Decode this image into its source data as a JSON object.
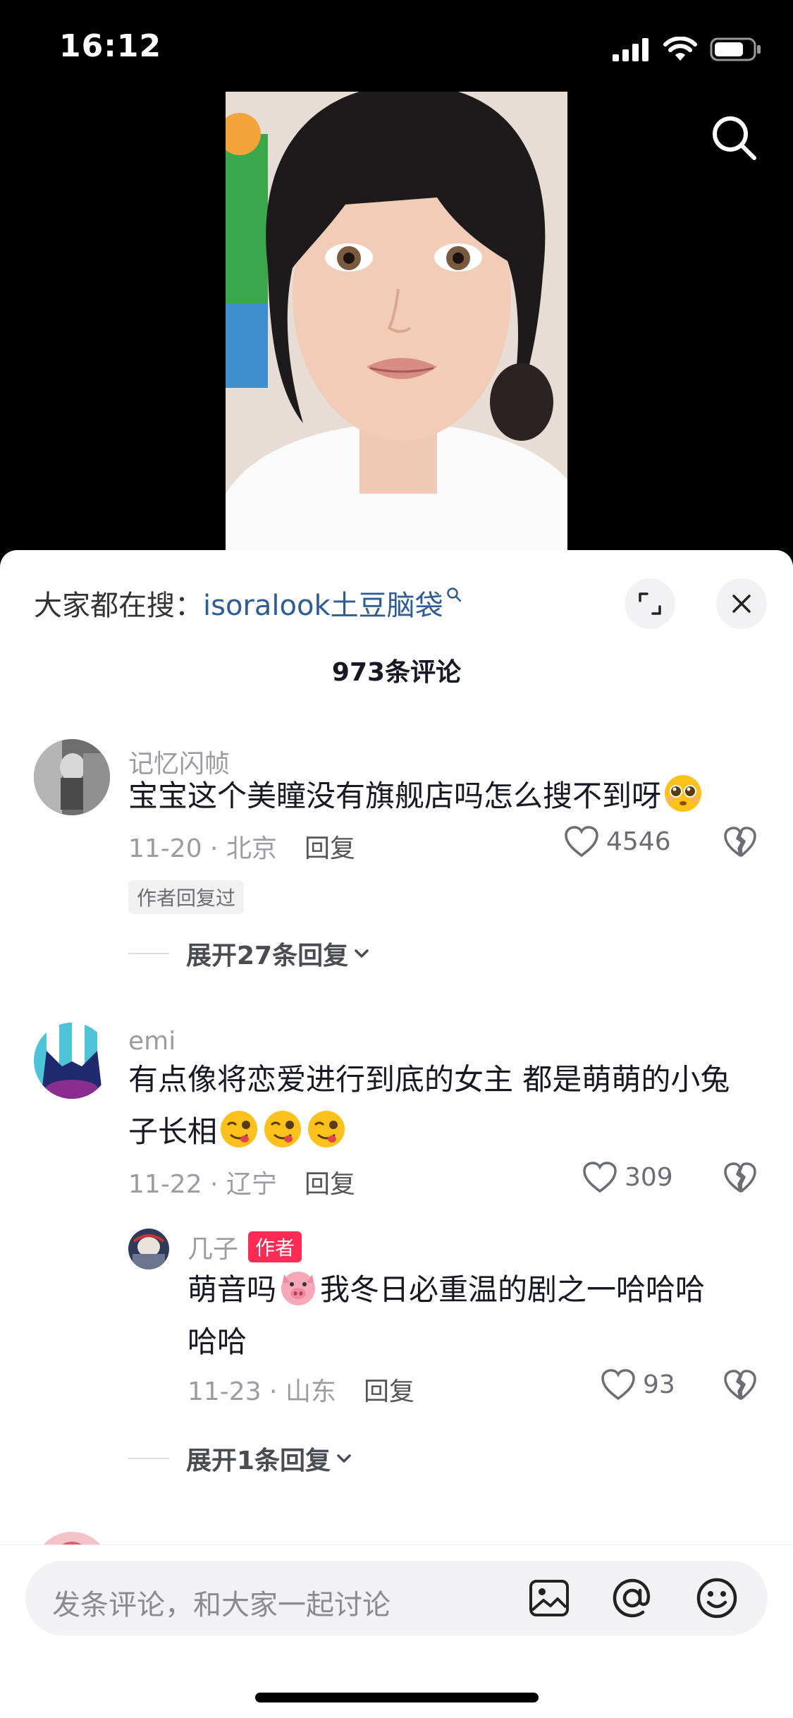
{
  "status_bar": {
    "time": "16:12"
  },
  "search_bar": {
    "prefix": "大家都在搜：",
    "term": "isoralook土豆脑袋"
  },
  "comments_header": {
    "count_label": "973条评论"
  },
  "comments": [
    {
      "user": "记忆闪帧",
      "text": "宝宝这个美瞳没有旗舰店吗怎么搜不到呀",
      "date_location": "11-20 · 北京",
      "reply_label": "回复",
      "likes": "4546",
      "badge": "作者回复过",
      "expand_label": "展开27条回复"
    },
    {
      "user": "emi",
      "text_line1": "有点像将恋爱进行到底的女主 都是萌萌的小兔",
      "text_line2": "子长相",
      "date_location": "11-22 · 辽宁",
      "reply_label": "回复",
      "likes": "309",
      "reply": {
        "user": "几子",
        "author_tag": "作者",
        "text_part1": "萌音吗",
        "text_part2": "我冬日必重温的剧之一哈哈哈",
        "text_line2": "哈哈",
        "date_location": "11-23 · 山东",
        "reply_label": "回复",
        "likes": "93"
      },
      "expand_label": "展开1条回复"
    }
  ],
  "input_bar": {
    "placeholder": "发条评论，和大家一起讨论"
  },
  "icons": [
    "search-icon",
    "expand-icon",
    "close-icon",
    "heart-icon",
    "broken-heart-icon",
    "chevron-down-icon",
    "image-icon",
    "at-icon",
    "smiley-icon",
    "pleading-face-emoji",
    "yummy-face-emoji",
    "pig-face-emoji"
  ],
  "colors": {
    "link": "#2e5c94",
    "author_tag": "#fe2c55",
    "muted": "#9a9ca3"
  }
}
